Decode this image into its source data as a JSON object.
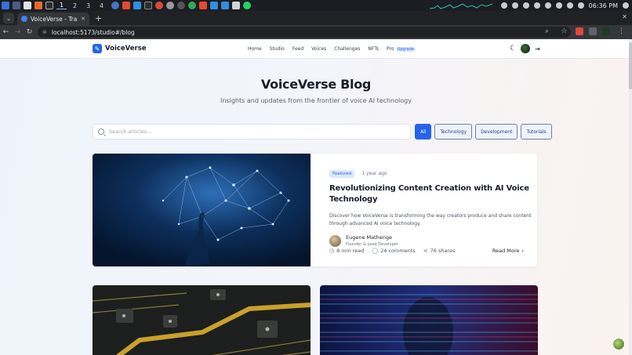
{
  "taskbar": {
    "workspaces": [
      "1",
      "2",
      "3",
      "4"
    ],
    "clock": "06:36 PM"
  },
  "browser": {
    "tab_title": "VoiceVerse - Transform",
    "url": "localhost:5173/studio#/blog",
    "icons": [
      "back-icon",
      "forward-icon",
      "reload-icon",
      "site-info-icon",
      "zoom-icon",
      "bookmark-star-icon",
      "extensions-icon",
      "profile-icon",
      "menu-icon"
    ]
  },
  "site": {
    "brand": "VoiceVerse",
    "nav": [
      "Home",
      "Studio",
      "Feed",
      "Voices",
      "Challenges",
      "NFTs",
      "Pro"
    ],
    "pro_badge": "Upgrade",
    "hero": {
      "title": "VoiceVerse Blog",
      "subtitle": "Insights and updates from the frontier of voice AI technology"
    },
    "search": {
      "placeholder": "Search articles..."
    },
    "filters": [
      "All",
      "Technology",
      "Development",
      "Tutorials"
    ],
    "active_filter": "All",
    "featured": {
      "tag": "Featured",
      "time_ago": "1 year ago",
      "title": "Revolutionizing Content Creation with AI Voice Technology",
      "description": "Discover how VoiceVerse is transforming the way creators produce and share content through advanced AI voice technology.",
      "author_name": "Eugene Mathenge",
      "author_role": "Founder & Lead Developer",
      "read_time": "8 min read",
      "comments": "24 comments",
      "shares": "76 shares",
      "read_more": "Read More"
    }
  }
}
